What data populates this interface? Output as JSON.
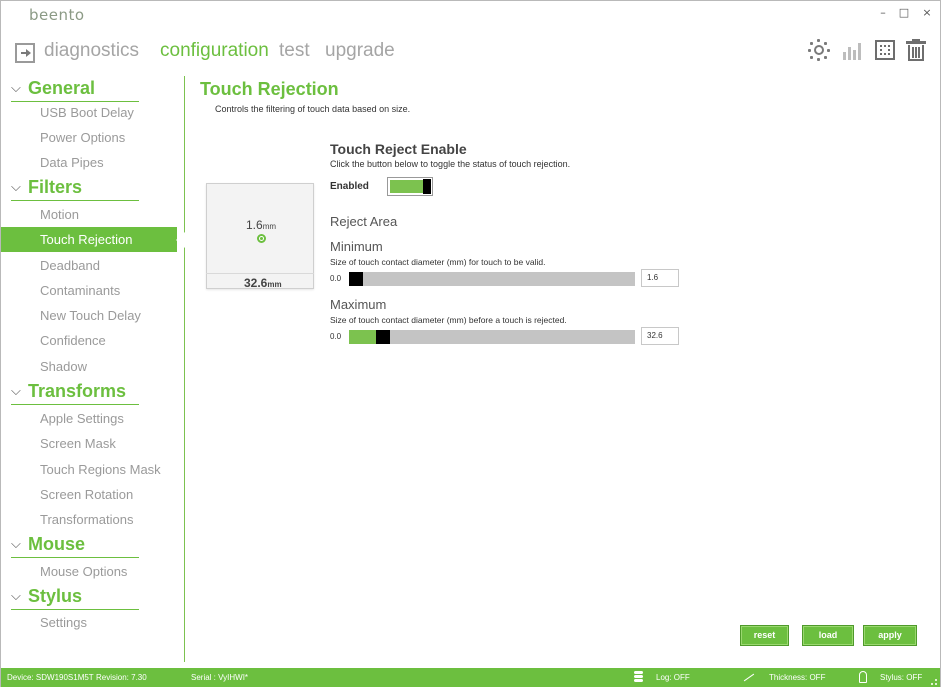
{
  "app": {
    "logo": "beento",
    "window_controls": {
      "minimize": "–",
      "maximize": "□",
      "close": "×"
    }
  },
  "nav": {
    "items": [
      {
        "label": "diagnostics",
        "active": false
      },
      {
        "label": "configuration",
        "active": true
      },
      {
        "label": "test",
        "active": false
      },
      {
        "label": "upgrade",
        "active": false
      }
    ],
    "toolbar_icons": [
      "sun-icon",
      "chart-icon",
      "fullscreen-icon",
      "trash-icon"
    ]
  },
  "sidebar": {
    "groups": [
      {
        "title": "General",
        "items": [
          "USB Boot Delay",
          "Power Options",
          "Data Pipes"
        ]
      },
      {
        "title": "Filters",
        "items": [
          "Motion",
          "Touch Rejection",
          "Deadband",
          "Contaminants",
          "New Touch Delay",
          "Confidence",
          "Shadow"
        ]
      },
      {
        "title": "Transforms",
        "items": [
          "Apple Settings",
          "Screen Mask",
          "Touch Regions Mask",
          "Screen Rotation",
          "Transformations"
        ]
      },
      {
        "title": "Mouse",
        "items": [
          "Mouse Options"
        ]
      },
      {
        "title": "Stylus",
        "items": [
          "Settings"
        ]
      }
    ],
    "active_item": "Touch Rejection"
  },
  "content": {
    "title": "Touch Rejection",
    "subtitle": "Controls the filtering of touch data based on size.",
    "preview": {
      "min_value": "1.6",
      "min_unit": "mm",
      "max_value": "32.6",
      "max_unit": "mm"
    },
    "reject_enable": {
      "title": "Touch Reject Enable",
      "description": "Click the button below to toggle the status of touch rejection.",
      "state_label": "Enabled",
      "enabled": true
    },
    "reject_area": {
      "title": "Reject Area",
      "minimum": {
        "title": "Minimum",
        "description": "Size of touch contact diameter (mm) for touch to be valid.",
        "range_min_label": "0.0",
        "value": "1.6",
        "fraction": 0.0
      },
      "maximum": {
        "title": "Maximum",
        "description": "Size of touch contact diameter (mm) before a touch is rejected.",
        "range_min_label": "0.0",
        "value": "32.6",
        "fraction": 0.1
      }
    },
    "buttons": {
      "reset": "reset",
      "load": "load",
      "apply": "apply"
    }
  },
  "status": {
    "device": "Device: SDW190S1M5T",
    "revision": "Revision: 7.30",
    "serial": "Serial : VyIHWI*",
    "log": "Log: OFF",
    "thickness": "Thickness: OFF",
    "stylus": "Stylus: OFF"
  },
  "colors": {
    "accent": "#6cbf3f",
    "slider_fill": "#7cc24f",
    "track": "#c4c4c4",
    "nav_inactive": "#a5a5a5"
  }
}
